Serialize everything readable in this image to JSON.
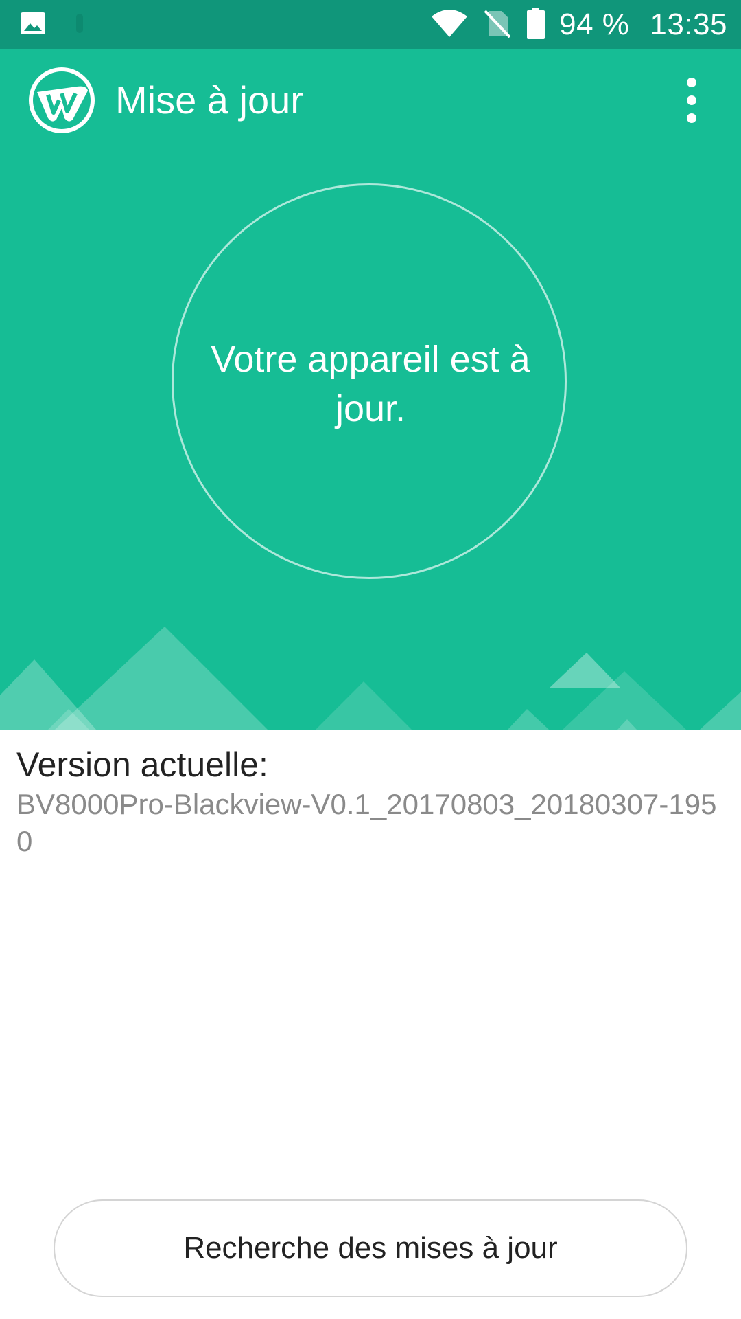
{
  "status_bar": {
    "battery_percent": "94 %",
    "time": "13:35",
    "icons": [
      "image-notification-icon",
      "wifi-icon",
      "no-sim-icon",
      "battery-icon"
    ]
  },
  "app_bar": {
    "title": "Mise à jour",
    "logo_icon": "update-app-logo-icon",
    "menu_icon": "more-vert-icon"
  },
  "status": {
    "message": "Votre appareil est à jour."
  },
  "version": {
    "label": "Version actuelle:",
    "value": "BV8000Pro-Blackview-V0.1_20170803_20180307-1950"
  },
  "actions": {
    "check_updates_label": "Recherche des mises à jour"
  },
  "colors": {
    "status_bar": "#10967a",
    "header": "#16bd95",
    "accent_text": "#ffffff"
  }
}
